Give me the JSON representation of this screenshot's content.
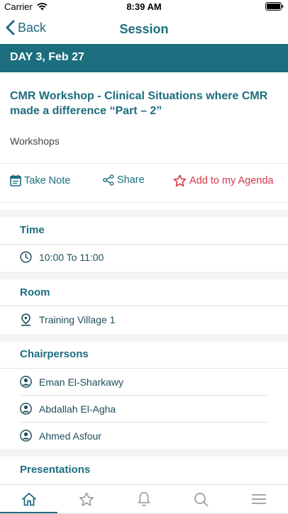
{
  "status_bar": {
    "carrier": "Carrier",
    "time": "8:39 AM"
  },
  "nav": {
    "back_label": "Back",
    "title": "Session"
  },
  "day_header": "DAY 3, Feb 27",
  "session": {
    "title": "CMR Workshop - Clinical Situations where CMR made a difference “Part – 2”",
    "category": "Workshops"
  },
  "actions": {
    "take_note": "Take Note",
    "share": "Share",
    "add_agenda": "Add to my Agenda"
  },
  "time_section": {
    "heading": "Time",
    "value": "10:00 To 11:00"
  },
  "room_section": {
    "heading": "Room",
    "value": "Training Village 1"
  },
  "chairpersons_section": {
    "heading": "Chairpersons",
    "people": [
      "Eman El-Sharkawy",
      "Abdallah El-Agha",
      "Ahmed Asfour"
    ]
  },
  "presentations_section": {
    "heading": "Presentations"
  },
  "tabs": [
    {
      "icon": "home-icon",
      "active": true
    },
    {
      "icon": "star-icon",
      "active": false
    },
    {
      "icon": "bell-icon",
      "active": false
    },
    {
      "icon": "search-icon",
      "active": false
    },
    {
      "icon": "menu-icon",
      "active": false
    }
  ],
  "colors": {
    "primary": "#1c6d7d",
    "agenda": "#d03a48",
    "band": "#f4f4f4"
  }
}
